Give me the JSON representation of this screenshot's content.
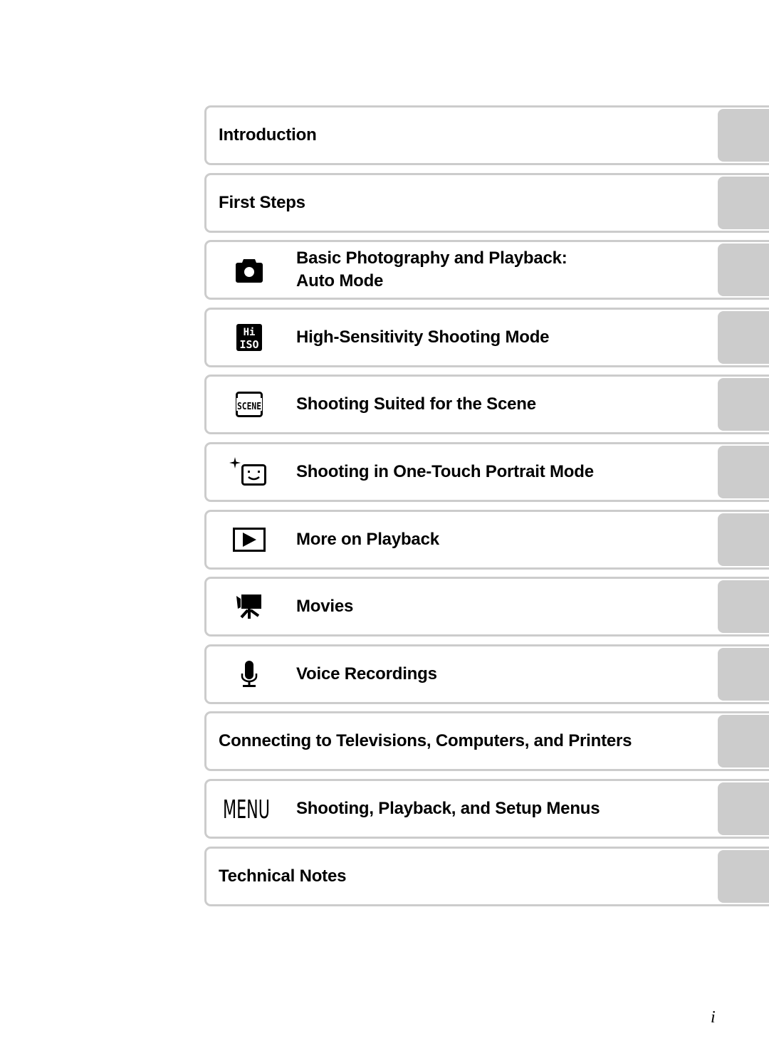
{
  "toc": {
    "items": [
      {
        "label": "Introduction",
        "icon": null
      },
      {
        "label": "First Steps",
        "icon": null
      },
      {
        "label": "Basic Photography and Playback:",
        "label2": "Auto Mode",
        "icon": "camera-icon"
      },
      {
        "label": "High-Sensitivity Shooting Mode",
        "icon": "hi-iso-icon"
      },
      {
        "label": "Shooting Suited for the Scene",
        "icon": "scene-icon"
      },
      {
        "label": "Shooting in One-Touch Portrait Mode",
        "icon": "portrait-face-icon"
      },
      {
        "label": "More on Playback",
        "icon": "playback-icon"
      },
      {
        "label": "Movies",
        "icon": "movie-camera-icon"
      },
      {
        "label": "Voice Recordings",
        "icon": "microphone-icon"
      },
      {
        "label": "Connecting to Televisions, Computers, and Printers",
        "icon": null
      },
      {
        "label": "Shooting, Playback, and Setup Menus",
        "icon": "menu-icon"
      },
      {
        "label": "Technical Notes",
        "icon": null
      }
    ]
  },
  "icons": {
    "hi_top": "Hi",
    "hi_bottom": "ISO",
    "scene": "SCENE",
    "menu": "MENU"
  },
  "page_number": "i",
  "colors": {
    "border": "#cccccc",
    "tab": "#cccccc",
    "text": "#000000"
  }
}
